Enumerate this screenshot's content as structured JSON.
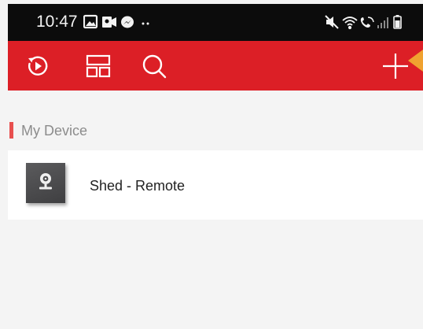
{
  "status_bar": {
    "time": "10:47",
    "left_icons": [
      "gallery-icon",
      "video-call-icon",
      "messenger-icon",
      "more-notifications-icon"
    ],
    "right_icons": [
      "mute-icon",
      "wifi-icon",
      "wifi-calling-icon",
      "signal-icon",
      "battery-icon"
    ]
  },
  "toolbar": {
    "background": "#dc1f26",
    "icons": [
      "playback-icon",
      "layout-icon",
      "search-icon",
      "add-icon"
    ]
  },
  "section": {
    "title": "My Device",
    "marker_color": "#e8504f"
  },
  "devices": [
    {
      "name": "Shed - Remote",
      "thumbnail_icon": "camera-icon"
    }
  ],
  "accent": {
    "tooltip_pointer": "#f0a230"
  }
}
